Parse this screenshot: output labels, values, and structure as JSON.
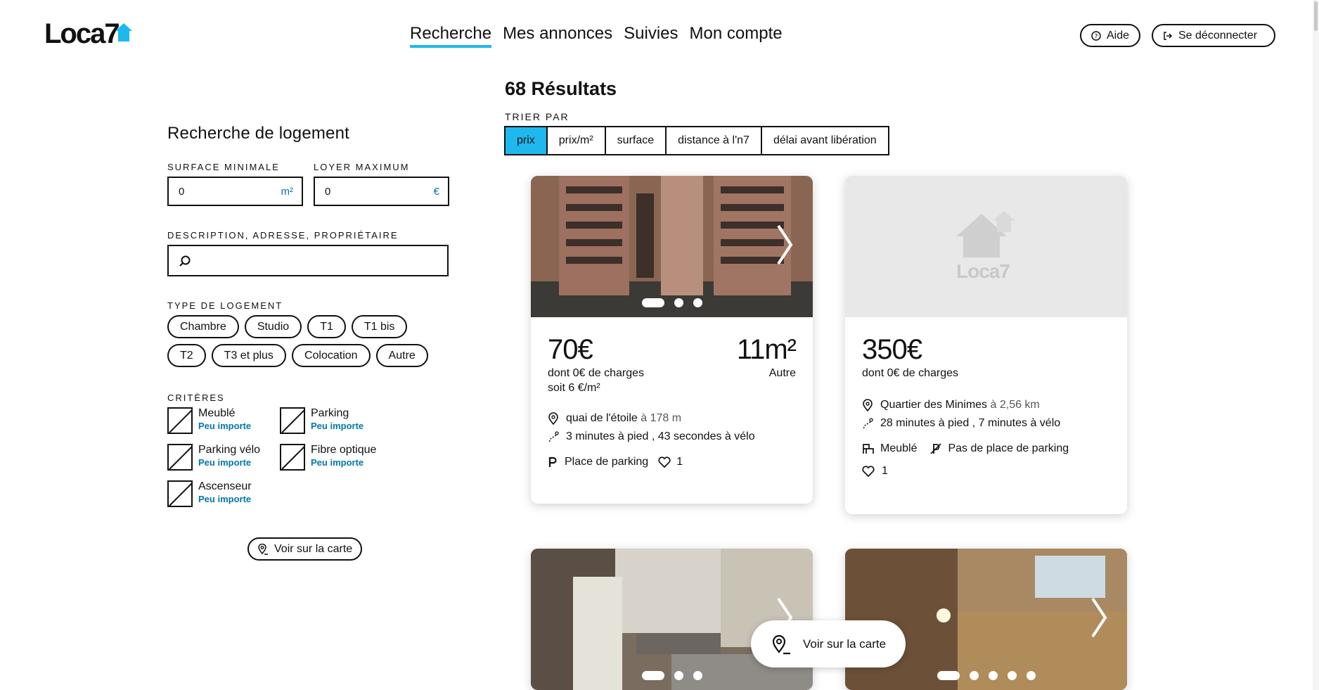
{
  "header": {
    "logo_text": "Loca7",
    "nav": [
      {
        "label": "Recherche",
        "active": true
      },
      {
        "label": "Mes annonces",
        "active": false
      },
      {
        "label": "Suivies",
        "active": false
      },
      {
        "label": "Mon compte",
        "active": false
      }
    ],
    "aide_label": "Aide",
    "logout_label": "Se déconnecter"
  },
  "sidebar": {
    "title": "Recherche de logement",
    "surface_label": "SURFACE MINIMALE",
    "surface_value": "0",
    "surface_unit": "m²",
    "loyer_label": "LOYER MAXIMUM",
    "loyer_value": "0",
    "loyer_unit": "€",
    "search_label": "DESCRIPTION, ADRESSE, PROPRIÉTAIRE",
    "search_value": "",
    "type_label": "TYPE DE LOGEMENT",
    "types": [
      "Chambre",
      "Studio",
      "T1",
      "T1 bis",
      "T2",
      "T3 et plus",
      "Colocation",
      "Autre"
    ],
    "criteria_label": "CRITÈRES",
    "criteria": [
      {
        "name": "Meublé",
        "value": "Peu importe"
      },
      {
        "name": "Parking",
        "value": "Peu importe"
      },
      {
        "name": "Parking vélo",
        "value": "Peu importe"
      },
      {
        "name": "Fibre optique",
        "value": "Peu importe"
      },
      {
        "name": "Ascenseur",
        "value": "Peu importe"
      }
    ],
    "map_button": "Voir sur la carte"
  },
  "results": {
    "count_text": "68 Résultats",
    "sort_label": "TRIER PAR",
    "sort_options": [
      {
        "label": "prix",
        "active": true
      },
      {
        "label": "prix/m²",
        "active": false
      },
      {
        "label": "surface",
        "active": false
      },
      {
        "label": "distance à l'n7",
        "active": false
      },
      {
        "label": "délai avant libération",
        "active": false
      }
    ],
    "cards": [
      {
        "price": "70€",
        "charges": "dont 0€ de charges",
        "per_m2": "soit 6 €/m²",
        "surface": "11m²",
        "type": "Autre",
        "address": "quai de l'étoile",
        "distance": "à 178 m",
        "travel": "3 minutes à pied , 43 secondes à vélo",
        "feature": "Place de parking",
        "likes": "1"
      },
      {
        "price": "350€",
        "charges": "dont 0€ de charges",
        "placeholder_logo": "Loca7",
        "address": "Quartier des Minimes",
        "distance": "à 2,56 km",
        "travel": "28 minutes à pied , 7 minutes à vélo",
        "feature_1": "Meublé",
        "feature_2": "Pas de place de parking",
        "likes": "1"
      }
    ],
    "float_map_button": "Voir sur la carte"
  },
  "colors": {
    "accent": "#1eb8ee",
    "link": "#0077aa"
  }
}
